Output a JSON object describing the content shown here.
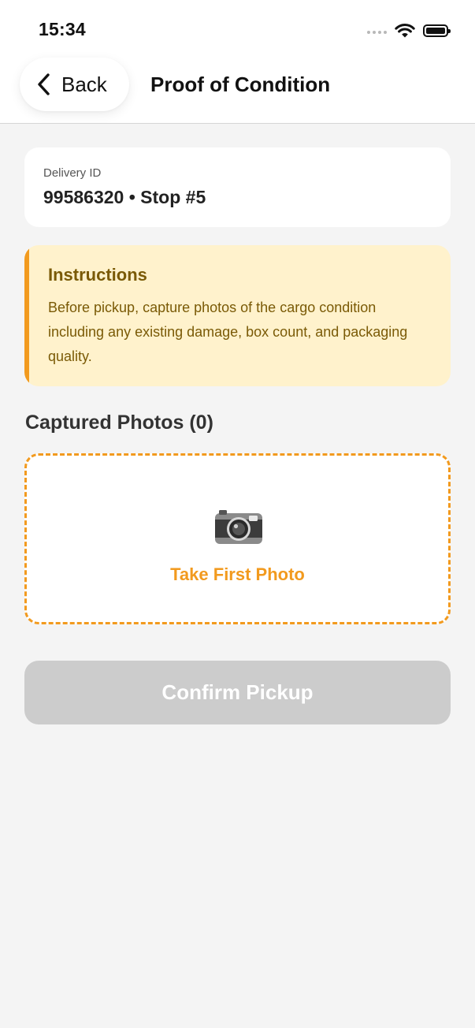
{
  "status_bar": {
    "time": "15:34",
    "icons": [
      "cellular-dots-icon",
      "wifi-icon",
      "battery-icon"
    ]
  },
  "header": {
    "back_label": "Back",
    "title": "Proof of Condition"
  },
  "delivery": {
    "caption": "Delivery ID",
    "value": "99586320 • Stop #5"
  },
  "instructions": {
    "heading": "Instructions",
    "body": "Before pickup, capture photos of the cargo condition including any existing damage, box count, and packaging quality."
  },
  "photos": {
    "section_title": "Captured Photos (0)",
    "capture_label": "Take First Photo",
    "capture_icon": "camera-icon"
  },
  "actions": {
    "confirm_label": "Confirm Pickup",
    "confirm_state": "disabled"
  },
  "colors": {
    "accent": "#f29a1e",
    "instructions_bg": "#fff2cc",
    "instructions_text": "#7a5a06",
    "disabled_button": "#cccccc",
    "background": "#f4f4f4"
  }
}
